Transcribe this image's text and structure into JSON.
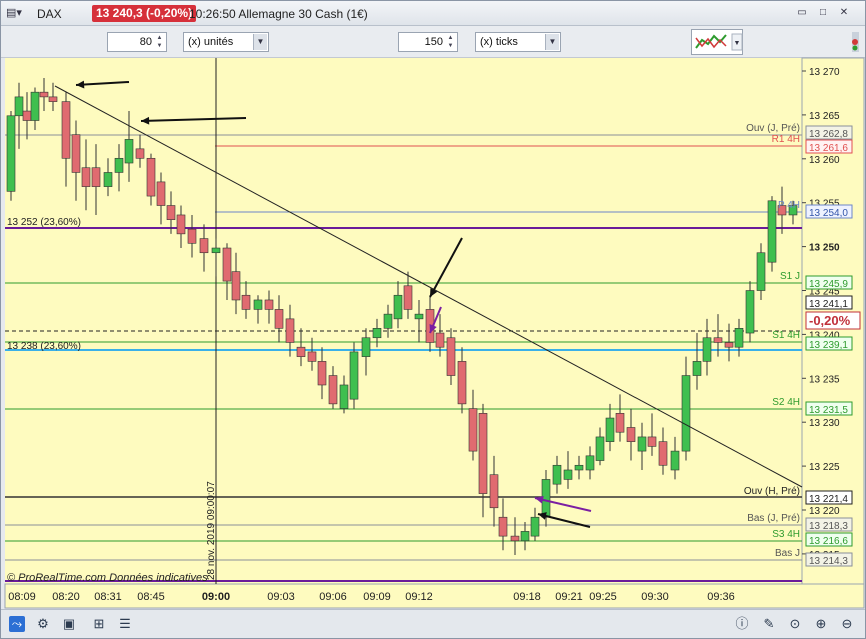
{
  "titlebar": {
    "symbol": "DAX",
    "price_badge": "13 240,3 (-0,20%)",
    "info": "10:26:50 Allemagne 30 Cash (1€)"
  },
  "controls": {
    "units_value": "80",
    "units_label": "(x) unités",
    "ticks_value": "150",
    "ticks_label": "(x) ticks"
  },
  "chart": {
    "footer_text": "© ProRealTime.com Données indicatives",
    "vertical_date": "28 nov. 2019 09:00:07",
    "level_left_1": "13 252 (23,60%)",
    "level_left_2": "13 238 (23,60%)",
    "current_change": "-0,20%",
    "right_labels": {
      "ouv_j": "Ouv (J, Pré)",
      "r1_4h": "R1 4H",
      "p_4h": "P 4H",
      "s1_j": "S1 J",
      "s1_4h": "S1 4H",
      "s2_4h": "S2 4H",
      "ouv_h": "Ouv (H, Pré)",
      "bas_j": "Bas (J, Pré)",
      "s3_4h": "S3 4H",
      "bas_j2": "Bas J"
    },
    "price_tags": {
      "ouv_j": "13 262,8",
      "r1_4h": "13 261,6",
      "p_4h": "13 254,0",
      "s1_j": "13 245,9",
      "last": "13 241,1",
      "s1_4h": "13 239,1",
      "s2_4h": "13 231,5",
      "ouv_h": "13 221,4",
      "bas_j": "13 218,3",
      "s3_4h": "13 216,6",
      "bas_j2": "13 214,3"
    },
    "axis_ticks": [
      "13 270",
      "13 265",
      "13 260",
      "13 255",
      "13 250",
      "13 245",
      "13 240",
      "13 235",
      "13 230",
      "13 225",
      "13 220",
      "13 215"
    ],
    "time_labels": [
      "08:09",
      "08:20",
      "08:31",
      "08:45",
      "09:00",
      "09:03",
      "09:06",
      "09:09",
      "09:12",
      "09:18",
      "09:21",
      "09:25",
      "09:30",
      "09:36"
    ]
  },
  "colors": {
    "up": "#3fbf4f",
    "down": "#e06b70",
    "background": "#fefbbf",
    "purple": "#6a1b9a",
    "green_line": "#2e9b2e",
    "blue_line": "#3ab0e8",
    "red_line": "#e05050"
  }
}
